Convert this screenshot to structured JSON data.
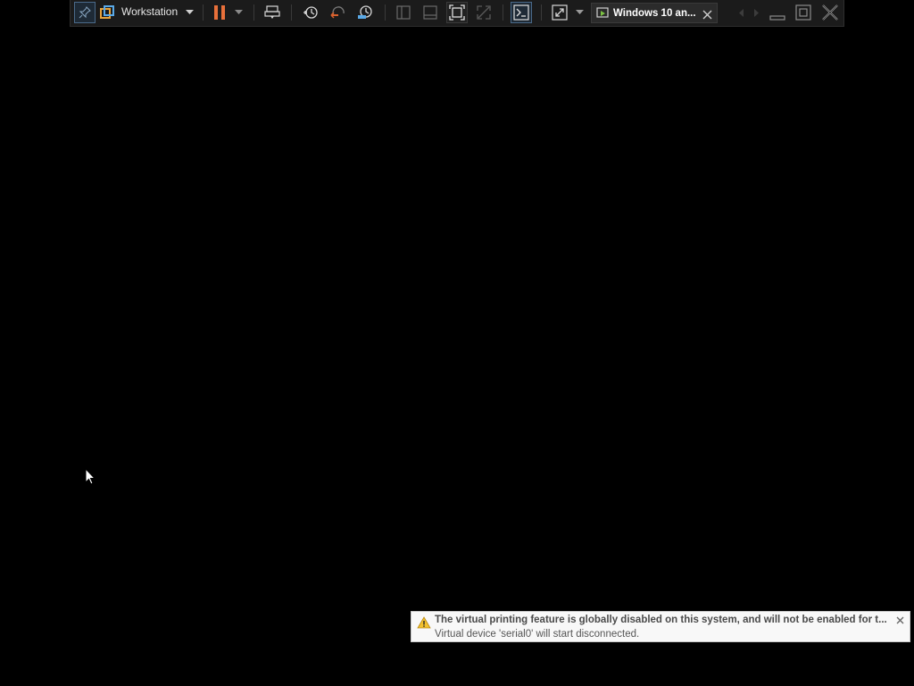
{
  "toolbar": {
    "product_label": "Workstation",
    "vm_tab_label": "Windows 10 an...",
    "icons": {
      "pin": "pin-icon",
      "product_logo": "vmware-logo-icon",
      "product_dropdown": "chevron-down-icon",
      "pause": "pause-icon",
      "power_dropdown": "chevron-down-icon",
      "send_ctrl_alt_del": "send-keys-icon",
      "snapshot_take": "snapshot-take-icon",
      "snapshot_revert": "snapshot-revert-icon",
      "snapshot_manager": "snapshot-manager-icon",
      "library": "library-panel-icon",
      "thumbnail_bar": "thumbnail-bar-icon",
      "fullscreen": "fullscreen-icon",
      "unity": "unity-icon",
      "console": "console-icon",
      "stretch": "stretch-guest-icon",
      "vm_tab": "vm-running-icon",
      "close_tab": "close-icon",
      "prev_tab": "chevron-left-icon",
      "next_tab": "chevron-right-icon",
      "minimize": "minimize-icon",
      "restore": "restore-icon",
      "exit": "close-icon"
    },
    "colors": {
      "background": "#1b1b1b",
      "pause_accent": "#e8703a",
      "snapshot_revert_accent": "#d9602c",
      "snapshot_manager_accent": "#5aa9e6",
      "vm_icon_accent": "#7cc242"
    }
  },
  "notification": {
    "title": "The virtual printing feature is globally disabled on this system, and will not be enabled for t...",
    "body": "Virtual device 'serial0' will start disconnected.",
    "icon": "warning-icon",
    "close_icon": "close-icon",
    "colors": {
      "background": "#f8f8f8",
      "warning": "#f2c12e"
    }
  },
  "screen": {
    "background": "#000000",
    "cursor_icon": "mouse-pointer-icon"
  }
}
